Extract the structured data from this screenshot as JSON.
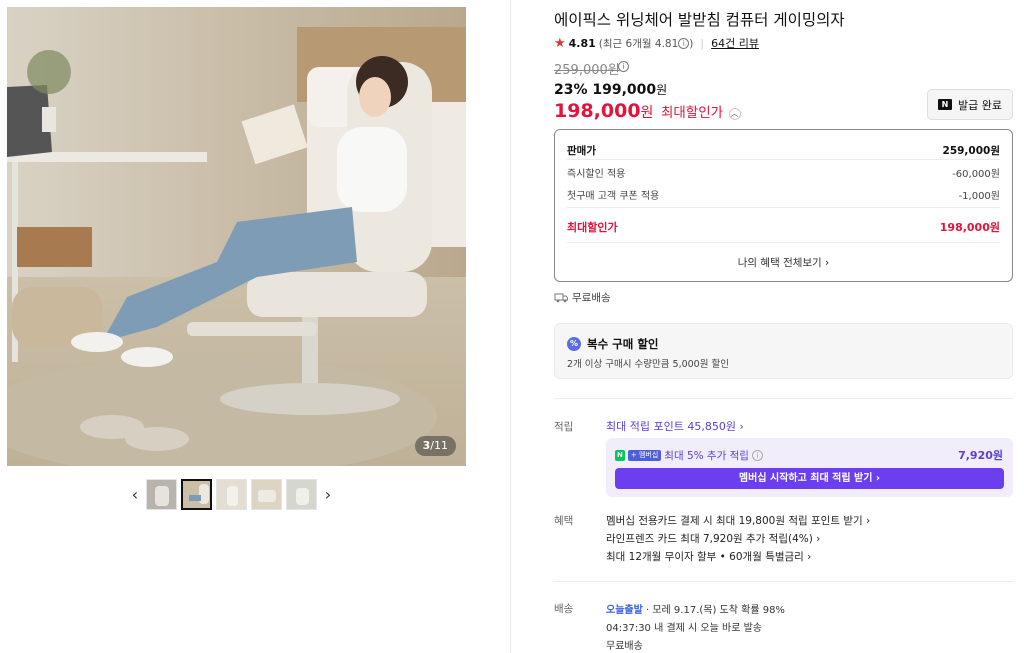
{
  "gallery": {
    "counter_current": "3",
    "counter_total": "/11",
    "prev_label": "‹",
    "next_label": "›",
    "thumbnails": [
      "thumb-1",
      "thumb-2",
      "thumb-3",
      "thumb-4",
      "thumb-5"
    ],
    "active_thumb_index": 1
  },
  "product": {
    "title": "에이픽스 위닝체어 발받침 컴퓨터 게이밍의자",
    "rating": "4.81",
    "rating_sub": "(최근 6개월 4.81",
    "rating_sub_close": ")",
    "review_link": "64건 리뷰",
    "original_price": "259,000원",
    "discount_pct": "23%",
    "discount_price": "199,000",
    "discount_unit": "원",
    "max_price": "198,000",
    "max_price_unit": "원",
    "max_price_label": "최대할인가",
    "coupon_button": "발급 완료",
    "coupon_badge": "N"
  },
  "breakdown": {
    "rows": [
      {
        "label": "판매가",
        "value": "259,000원"
      },
      {
        "label": "즉시할인 적용",
        "value": "-60,000원"
      },
      {
        "label": "첫구매 고객 쿠폰 적용",
        "value": "-1,000원"
      },
      {
        "label": "최대할인가",
        "value": "198,000원"
      }
    ],
    "more_link": "나의 혜택 전체보기 ›"
  },
  "shipping_mini": "무료배송",
  "multi_buy": {
    "badge": "%",
    "title": "복수 구매 할인",
    "desc": "2개 이상 구매시 수량만큼 5,000원 할인"
  },
  "points": {
    "label": "적립",
    "link": "최대 적립 포인트 45,850원 ›",
    "member_badge_n": "N",
    "member_badge_plus": "+ 멤버십",
    "member_text": "최대 5% 추가 적립",
    "member_amount": "7,920원",
    "member_button": "멤버십 시작하고 최대 적립 받기 ›"
  },
  "benefits": {
    "label": "혜택",
    "lines": [
      "멤버십 전용카드 결제 시 최대 19,800원 적립 포인트 받기 ›",
      "라인프렌즈 카드 최대 7,920원 추가 적립(4%) ›",
      "최대 12개월 무이자 할부 • 60개월 특별금리 ›"
    ]
  },
  "delivery": {
    "label": "배송",
    "today": "오늘출발",
    "arrival": " · 모레 9.17.(목) 도착 확률 98%",
    "cutoff": "04:37:30  내 결제 시 오늘 바로 발송",
    "free": "무료배송"
  }
}
